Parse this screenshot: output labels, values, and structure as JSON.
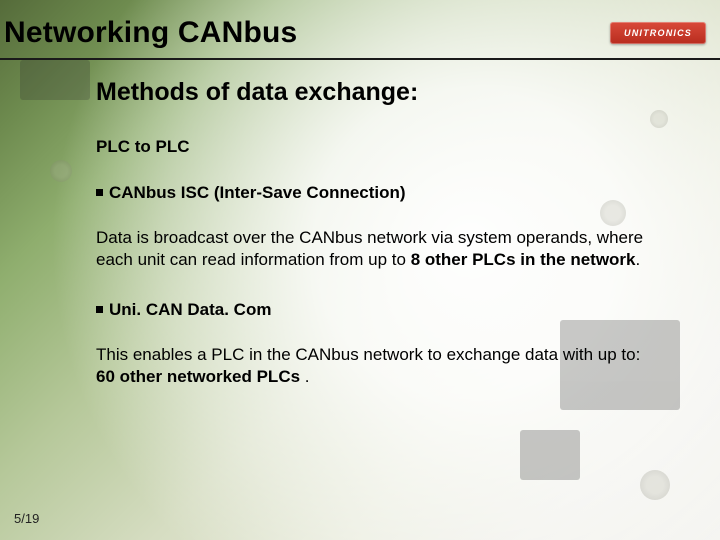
{
  "header": {
    "title": "Networking CANbus",
    "logo_text": "UNITRONICS"
  },
  "content": {
    "subtitle": "Methods of data exchange:",
    "section_heading": "PLC to PLC",
    "bullet1": "CANbus ISC (Inter-Save Connection)",
    "para1_pre": "Data is broadcast over the CANbus network via system operands, where each unit can read information from up to ",
    "para1_strong": "8 other PLCs in the network",
    "para1_post": ".",
    "bullet2": "Uni. CAN Data. Com",
    "para2_pre": "This enables a PLC in the CANbus network to exchange data with up to: ",
    "para2_strong": "60 other networked PLCs",
    "para2_post": " ."
  },
  "footer": {
    "page": "5/19"
  }
}
